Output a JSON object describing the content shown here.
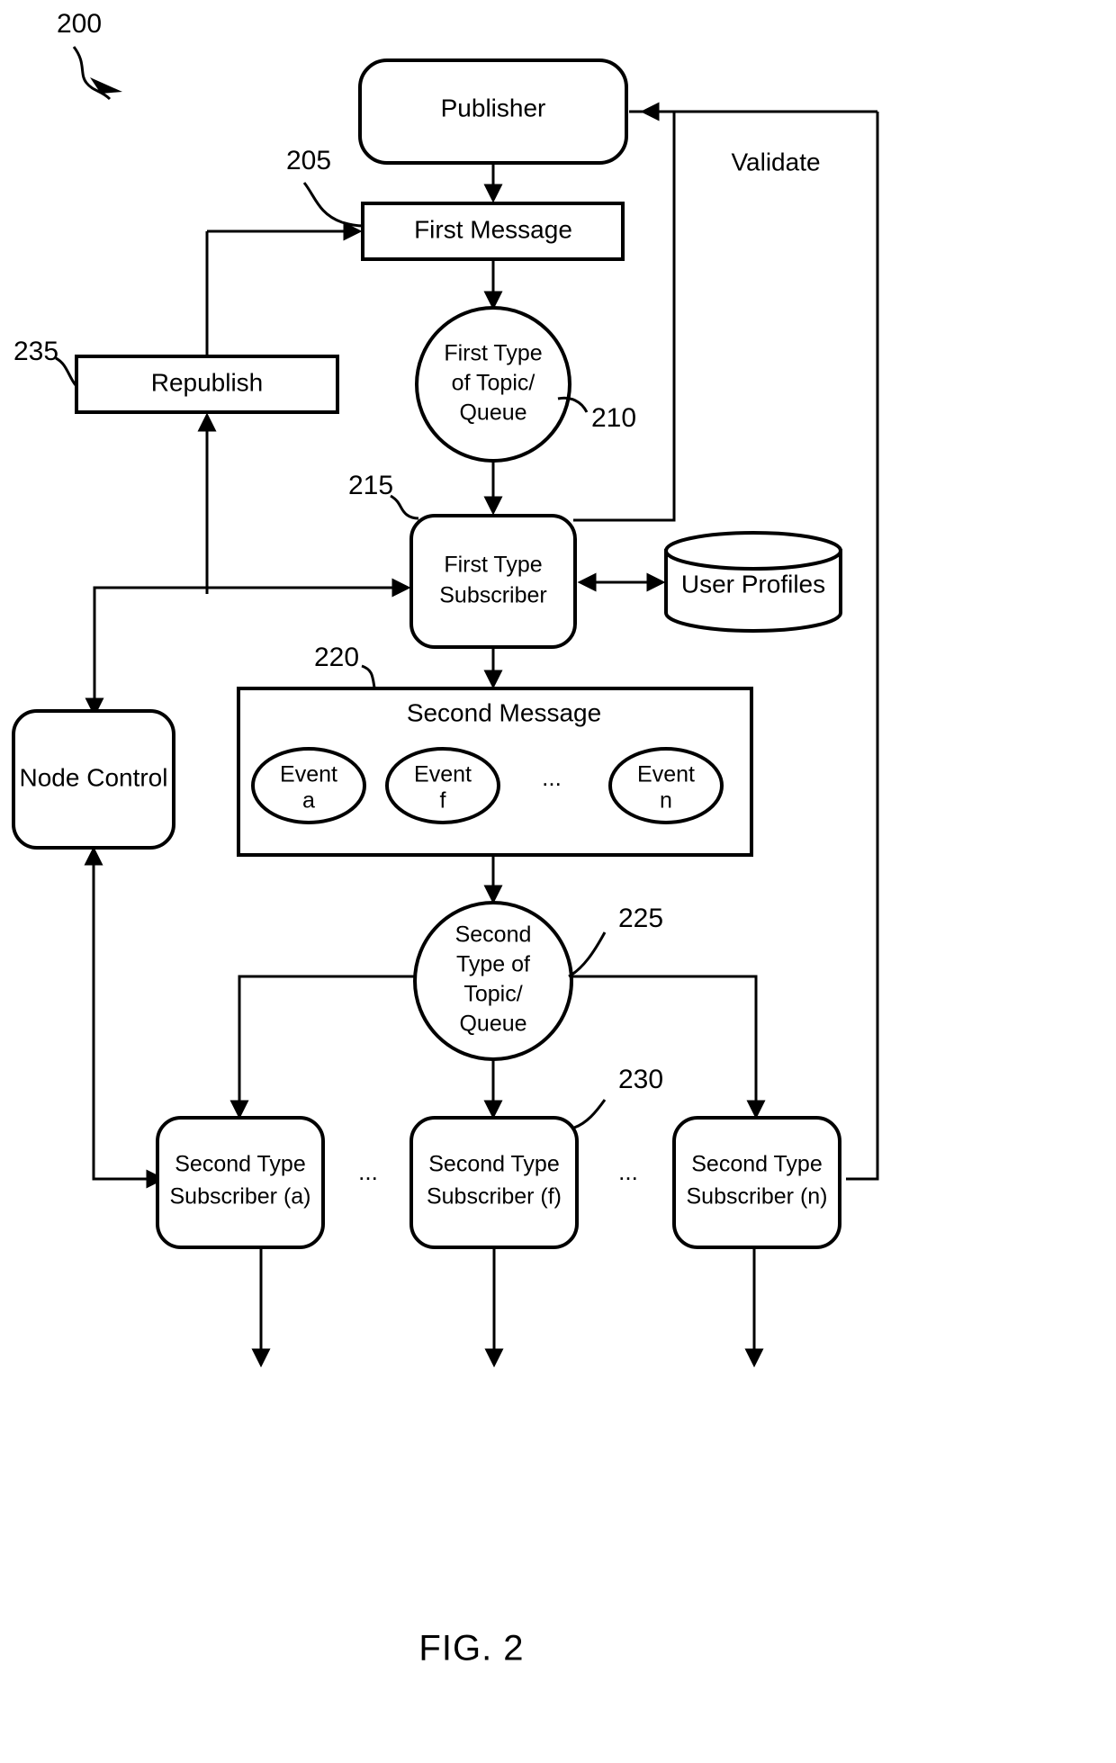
{
  "figure": {
    "caption": "FIG. 2",
    "diagram_number": "200"
  },
  "nodes": {
    "publisher": {
      "label": "Publisher"
    },
    "first_message": {
      "label": "First Message",
      "ref": "205"
    },
    "first_topic_queue": {
      "line1": "First Type",
      "line2": "of Topic/",
      "line3": "Queue",
      "ref": "210"
    },
    "republish": {
      "label": "Republish",
      "ref": "235"
    },
    "first_subscriber": {
      "line1": "First Type",
      "line2": "Subscriber",
      "ref": "215"
    },
    "user_profiles": {
      "label": "User Profiles"
    },
    "node_control": {
      "label": "Node Control"
    },
    "second_message": {
      "label": "Second Message",
      "ref": "220"
    },
    "second_topic_queue": {
      "line1": "Second",
      "line2": "Type of",
      "line3": "Topic/",
      "line4": "Queue",
      "ref": "225"
    },
    "second_subscribers": {
      "ref": "230",
      "items": [
        {
          "line1": "Second Type",
          "line2": "Subscriber (a)"
        },
        {
          "line1": "Second Type",
          "line2": "Subscriber (f)"
        },
        {
          "line1": "Second Type",
          "line2": "Subscriber (n)"
        }
      ]
    }
  },
  "events": {
    "items": [
      {
        "line1": "Event",
        "line2": "a"
      },
      {
        "line1": "Event",
        "line2": "f"
      },
      {
        "line1": "Event",
        "line2": "n"
      }
    ],
    "ellipsis": "..."
  },
  "separators": {
    "ellipsis_1": "...",
    "ellipsis_2": "..."
  },
  "edges": {
    "validate": {
      "label": "Validate"
    }
  },
  "colors": {
    "line": "#000000",
    "background": "#ffffff",
    "text": "#000000"
  }
}
